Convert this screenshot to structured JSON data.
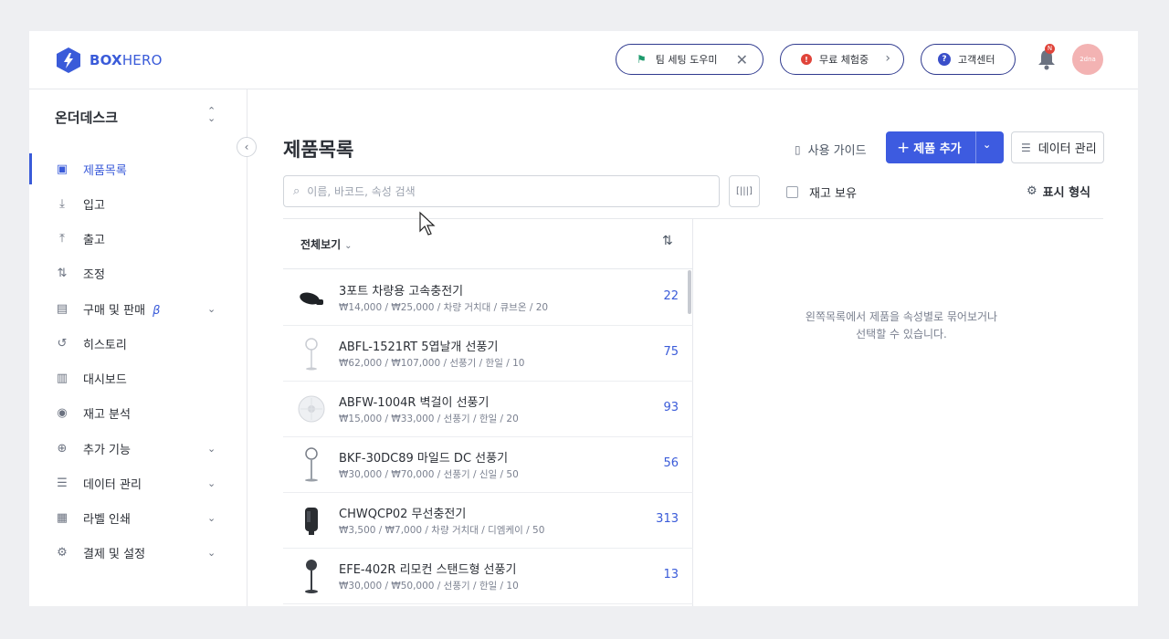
{
  "brand": {
    "name_bold": "BOX",
    "name_light": "HERO",
    "accent": "#3a5bd9"
  },
  "topbar": {
    "setup_guide": "팀 세팅 도우미",
    "trial": "무료 체험중",
    "support": "고객센터",
    "notification_badge": "N",
    "avatar_text": "2dna"
  },
  "sidebar": {
    "workspace": "온더데스크",
    "items": [
      {
        "label": "제품목록",
        "icon": "box-icon"
      },
      {
        "label": "입고",
        "icon": "arrow-down-icon"
      },
      {
        "label": "출고",
        "icon": "arrow-up-icon"
      },
      {
        "label": "조정",
        "icon": "swap-icon"
      },
      {
        "label": "구매 및 판매",
        "icon": "document-icon",
        "beta": "β"
      },
      {
        "label": "히스토리",
        "icon": "history-icon"
      },
      {
        "label": "대시보드",
        "icon": "chart-icon"
      },
      {
        "label": "재고 분석",
        "icon": "eye-icon"
      },
      {
        "label": "추가 기능",
        "icon": "plus-circle-icon"
      },
      {
        "label": "데이터 관리",
        "icon": "database-icon"
      },
      {
        "label": "라벨 인쇄",
        "icon": "barcode-icon"
      },
      {
        "label": "결제 및 설정",
        "icon": "gear-icon"
      }
    ]
  },
  "main": {
    "title": "제품목록",
    "guide": "사용 가이드",
    "add_product": "제품 추가",
    "data_manage": "데이터 관리",
    "search_placeholder": "이름, 바코드, 속성 검색",
    "in_stock": "재고 보유",
    "display_format": "표시 형식",
    "filter": "전체보기",
    "empty_line1": "왼쪽목록에서 제품을 속성별로 묶어보거나",
    "empty_line2": "선택할 수 있습니다."
  },
  "products": [
    {
      "name": "3포트 차량용 고속충전기",
      "meta": "₩14,000 / ₩25,000 / 차량 거치대 / 큐브온 / 20",
      "qty": "22"
    },
    {
      "name": "ABFL-1521RT 5엽날개 선풍기",
      "meta": "₩62,000 / ₩107,000 / 선풍기 / 한일 / 10",
      "qty": "75"
    },
    {
      "name": "ABFW-1004R 벽걸이 선풍기",
      "meta": "₩15,000 / ₩33,000 / 선풍기 / 한일 / 20",
      "qty": "93"
    },
    {
      "name": "BKF-30DC89 마일드 DC 선풍기",
      "meta": "₩30,000 / ₩70,000 / 선풍기 / 신일 / 50",
      "qty": "56"
    },
    {
      "name": "CHWQCP02 무선충전기",
      "meta": "₩3,500 / ₩7,000 / 차량 거치대 / 디엠케이 / 50",
      "qty": "313"
    },
    {
      "name": "EFE-402R 리모컨 스탠드형 선풍기",
      "meta": "₩30,000 / ₩50,000 / 선풍기 / 한일 / 10",
      "qty": "13"
    }
  ]
}
